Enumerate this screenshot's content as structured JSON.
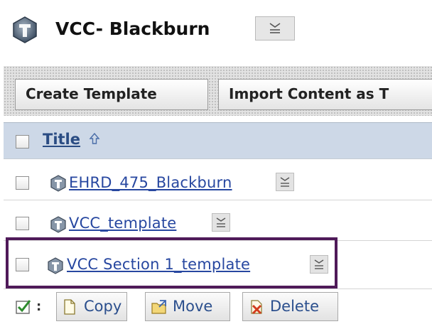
{
  "header": {
    "title": "VCC- Blackburn",
    "icon": "template-folder-icon",
    "menu_icon": "chevron-down-menu-icon"
  },
  "toolbar": {
    "create_label": "Create Template",
    "import_label": "Import Content as T"
  },
  "table": {
    "title_column_label": "Title",
    "sort_icon": "sort-ascending-arrow-icon",
    "rows": [
      {
        "label": "EHRD_475_Blackburn",
        "icon": "template-icon"
      },
      {
        "label": "VCC_template",
        "icon": "template-icon"
      },
      {
        "label": "VCC Section 1_template",
        "icon": "template-icon"
      }
    ]
  },
  "actions": {
    "copy_label": "Copy",
    "move_label": "Move",
    "delete_label": "Delete",
    "select_all_icon": "select-all-checkbox-icon"
  },
  "colors": {
    "header_row": "#cdd8e7",
    "link": "#2747a0",
    "highlight_border": "#4f1a59"
  }
}
